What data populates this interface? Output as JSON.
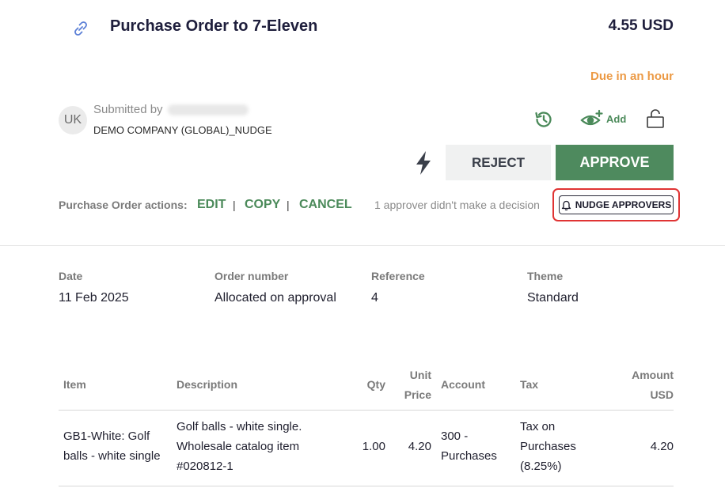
{
  "header": {
    "link_icon": "link-icon",
    "title": "Purchase Order to 7-Eleven",
    "amount": "4.55 USD",
    "due": "Due in an hour"
  },
  "submitter": {
    "initials": "UK",
    "submitted_by": "Submitted by",
    "company": "DEMO COMPANY (GLOBAL)_NUDGE"
  },
  "toolbar": {
    "history_icon": "history-icon",
    "watch_icon": "eye-plus-icon",
    "watch_label": "Add",
    "lock_icon": "unlock-icon",
    "bolt_icon": "lightning-icon",
    "reject_label": "REJECT",
    "approve_label": "APPROVE"
  },
  "actions": {
    "label": "Purchase Order actions:",
    "edit": "EDIT",
    "copy": "COPY",
    "cancel": "CANCEL",
    "separator": "|",
    "undecided_text": "1 approver didn't make a decision",
    "nudge_label": "NUDGE APPROVERS",
    "nudge_icon": "bell-icon"
  },
  "meta": [
    {
      "label": "Date",
      "value": "11 Feb 2025"
    },
    {
      "label": "Order number",
      "value": "Allocated on approval"
    },
    {
      "label": "Reference",
      "value": "4"
    },
    {
      "label": "Theme",
      "value": "Standard"
    }
  ],
  "table": {
    "headers": {
      "item": "Item",
      "description": "Description",
      "qty": "Qty",
      "unit_price_1": "Unit",
      "unit_price_2": "Price",
      "account": "Account",
      "tax": "Tax",
      "amount_1": "Amount",
      "amount_2": "USD"
    },
    "rows": [
      {
        "item_1": "GB1-White: Golf",
        "item_2": "balls - white single",
        "desc_1": "Golf balls - white single.",
        "desc_2": "Wholesale catalog item",
        "desc_3": "#020812-1",
        "qty": "1.00",
        "unit_price": "4.20",
        "account_1": "300 -",
        "account_2": "Purchases",
        "tax_1": "Tax on",
        "tax_2": "Purchases",
        "tax_3": "(8.25%)",
        "amount": "4.20"
      }
    ]
  },
  "colors": {
    "accent_green": "#4e8a5e",
    "due_orange": "#ec9a45",
    "highlight_red": "#e03434"
  }
}
